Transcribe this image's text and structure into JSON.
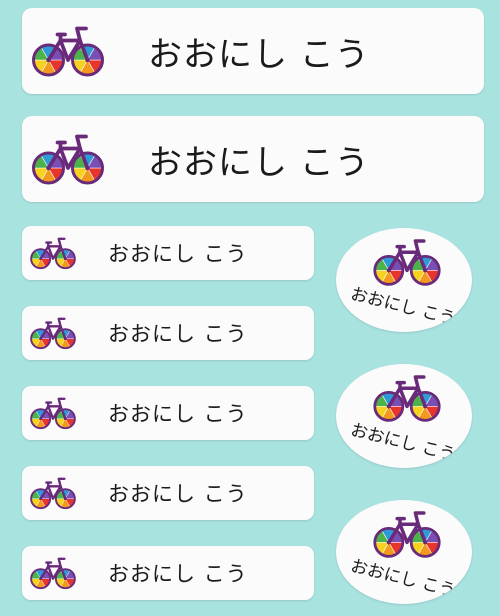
{
  "label_text": "おおにし こう",
  "stickers": [
    {
      "size": "large",
      "text": "おおにし こう",
      "icon": "bicycle-icon"
    },
    {
      "size": "large",
      "text": "おおにし こう",
      "icon": "bicycle-icon"
    },
    {
      "size": "small",
      "text": "おおにし こう",
      "icon": "bicycle-icon"
    },
    {
      "size": "small",
      "text": "おおにし こう",
      "icon": "bicycle-icon"
    },
    {
      "size": "small",
      "text": "おおにし こう",
      "icon": "bicycle-icon"
    },
    {
      "size": "small",
      "text": "おおにし こう",
      "icon": "bicycle-icon"
    },
    {
      "size": "small",
      "text": "おおにし こう",
      "icon": "bicycle-icon"
    }
  ],
  "oval_stickers": [
    {
      "text": "おおにし こう",
      "icon": "bicycle-icon"
    },
    {
      "text": "おおにし こう",
      "icon": "bicycle-icon"
    },
    {
      "text": "おおにし こう",
      "icon": "bicycle-icon"
    }
  ],
  "colors": {
    "background": "#a9e3e0",
    "sticker": "#fbfbfb",
    "frame": "#6a2a7a",
    "text": "#1a1a1a"
  }
}
